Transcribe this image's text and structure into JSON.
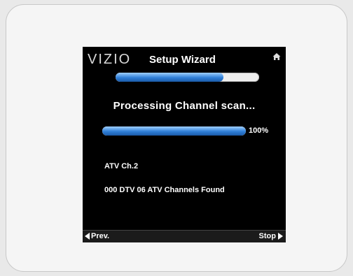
{
  "header": {
    "logo": "VIZIO",
    "title": "Setup Wizard",
    "home_icon": "home-icon"
  },
  "wizard_progress": {
    "fraction": 0.75
  },
  "scan": {
    "heading": "Processing Channel scan...",
    "progress_fraction": 1.0,
    "percent_label": "100%"
  },
  "status": {
    "current_channel": "ATV Ch.2",
    "channels_found": "000 DTV 06 ATV Channels Found"
  },
  "footer": {
    "prev_label": "Prev.",
    "stop_label": "Stop"
  },
  "colors": {
    "bar_fill": "#2f7fd8",
    "screen_bg": "#000000",
    "frame_bg": "#f5f5f5"
  }
}
